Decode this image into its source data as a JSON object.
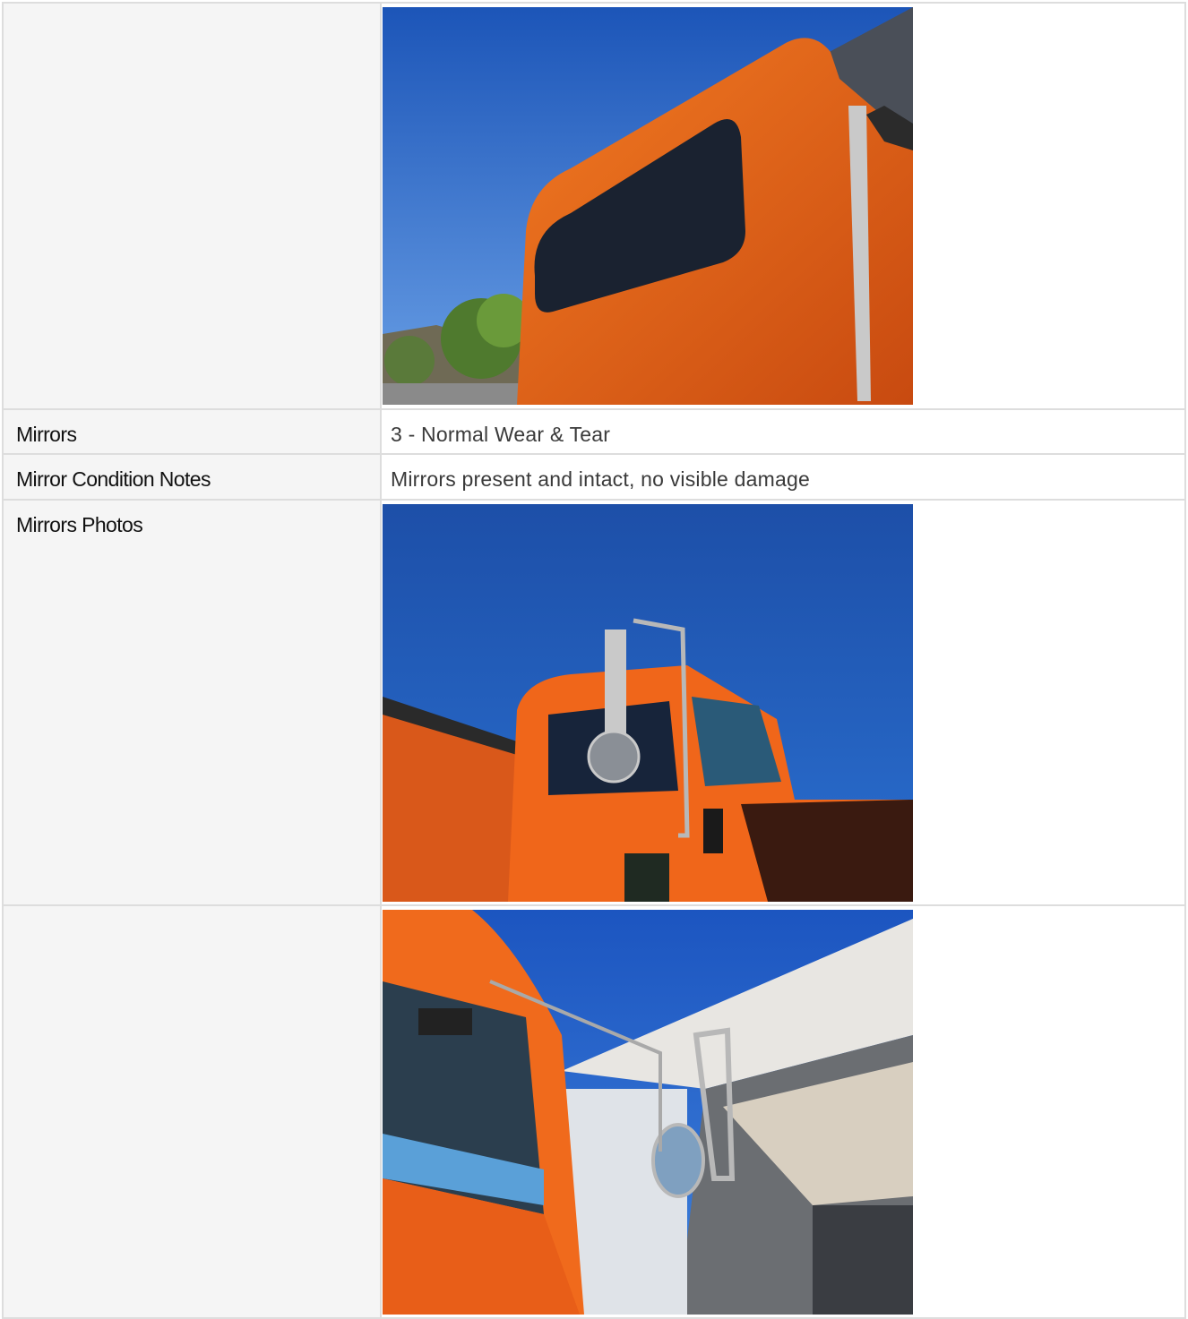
{
  "rows": {
    "mirrors": {
      "label": "Mirrors",
      "value": "3 - Normal Wear & Tear"
    },
    "mirror_notes": {
      "label": "Mirror Condition Notes",
      "value": "Mirrors present and intact, no visible damage"
    },
    "mirror_photos": {
      "label": "Mirrors Photos"
    }
  },
  "photos": [
    {
      "subject": "orange truck cab with rear window against blue sky"
    },
    {
      "subject": "orange truck cab side with chrome mirror assembly"
    },
    {
      "subject": "orange truck cab with round convex mirror near building canopy"
    }
  ],
  "colors": {
    "border": "#dddddd",
    "label_bg": "#f5f5f5",
    "truck_orange": "#f06a1c",
    "sky_blue": "#1f5fbf"
  }
}
